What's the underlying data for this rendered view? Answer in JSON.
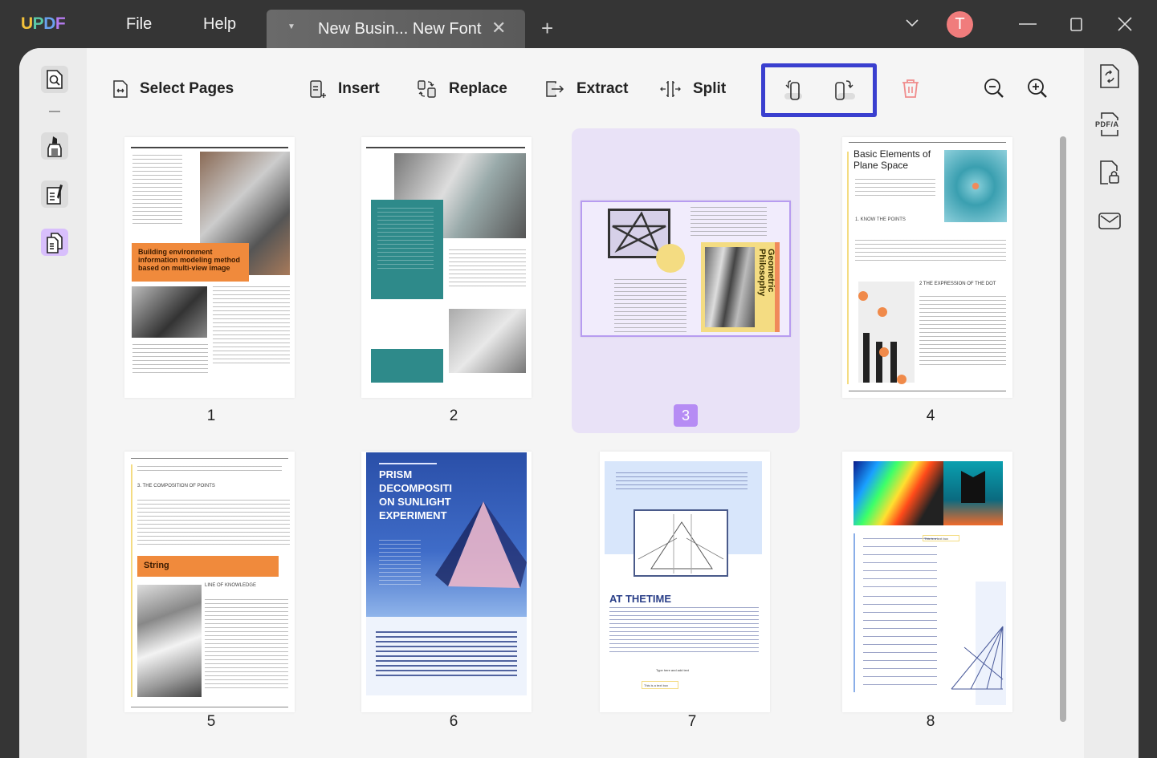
{
  "app": {
    "logo": "UPDF",
    "menu": [
      "File",
      "Help"
    ],
    "tab_title": "New Busin... New Font",
    "avatar_initial": "T",
    "avatar_color": "#f07c7c"
  },
  "left_sidebar": {
    "items": [
      {
        "name": "reader",
        "icon": "document-search-icon"
      },
      {
        "name": "comment",
        "icon": "highlighter-icon"
      },
      {
        "name": "edit",
        "icon": "edit-document-icon"
      },
      {
        "name": "organize-pages",
        "icon": "pages-icon",
        "active": true
      }
    ],
    "active_color": "#d8bffc"
  },
  "toolbar": {
    "select_pages": "Select Pages",
    "insert": "Insert",
    "replace": "Replace",
    "extract": "Extract",
    "split": "Split",
    "rotate_left": "rotate-left-icon",
    "rotate_right": "rotate-right-icon",
    "delete": "trash-icon",
    "zoom_out": "zoom-out-icon",
    "zoom_in": "zoom-in-icon",
    "highlight_color": "#3a3fcf",
    "delete_color": "#f08c8c"
  },
  "right_sidebar": {
    "items": [
      "convert-icon",
      "pdfa-icon",
      "protect-icon",
      "email-icon"
    ],
    "pdfa_label": "PDF/A"
  },
  "pages": [
    {
      "number": "1",
      "heading": "Building environment information modeling method based on multi-view image"
    },
    {
      "number": "2",
      "heading": ""
    },
    {
      "number": "3",
      "heading": "Geometric Philosophy",
      "selected": true
    },
    {
      "number": "4",
      "heading": "Basic Elements of Plane Space",
      "sub1": "1. KNOW THE POINTS",
      "sub2": "2 THE EXPRESSION OF THE DOT"
    },
    {
      "number": "5",
      "heading": "3. THE COMPOSITION OF POINTS",
      "banner": "String",
      "sub": "LINE OF KNOWLEDGE"
    },
    {
      "number": "6",
      "heading": "PRISM DECOMPOSITI ON SUNLIGHT EXPERIMENT"
    },
    {
      "number": "7",
      "heading": "AT THETIME",
      "note1": "Type here and add text",
      "note2": "This is a text box"
    },
    {
      "number": "8",
      "heading": "",
      "note": "This is a text box"
    }
  ]
}
